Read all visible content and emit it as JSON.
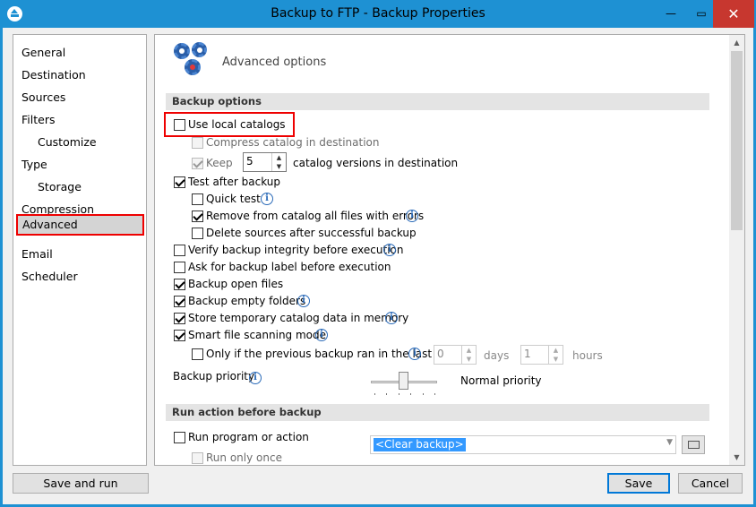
{
  "window": {
    "title": "Backup to FTP - Backup Properties",
    "min_glyph": "—",
    "max_glyph": "▭",
    "close_glyph": "✕"
  },
  "nav": {
    "items": [
      {
        "label": "General"
      },
      {
        "label": "Destination"
      },
      {
        "label": "Sources"
      },
      {
        "label": "Filters"
      },
      {
        "label": "Customize"
      },
      {
        "label": "Type"
      },
      {
        "label": "Storage"
      },
      {
        "label": "Compression"
      },
      {
        "label": "Advanced",
        "selected": true
      },
      {
        "label": "Email"
      },
      {
        "label": "Scheduler"
      }
    ]
  },
  "header": {
    "title": "Advanced options",
    "icon": "gears-icon"
  },
  "sections": {
    "backup_options": "Backup options",
    "run_action": "Run action before backup"
  },
  "options": {
    "use_local_catalogs": {
      "label": "Use local catalogs",
      "checked": false
    },
    "compress_catalog": {
      "label": "Compress catalog in destination",
      "checked": false,
      "disabled": true
    },
    "keep": {
      "label": "Keep",
      "checked": true,
      "disabled": true,
      "value": "5",
      "suffix": "catalog versions in destination"
    },
    "test_after_backup": {
      "label": "Test after backup",
      "checked": true
    },
    "quick_test": {
      "label": "Quick test",
      "checked": false
    },
    "remove_from_catalog": {
      "label": "Remove from catalog all files with errors",
      "checked": true
    },
    "delete_sources": {
      "label": "Delete sources after successful backup",
      "checked": false
    },
    "verify_integrity": {
      "label": "Verify backup integrity before execution",
      "checked": false
    },
    "ask_label": {
      "label": "Ask for backup label before execution",
      "checked": false
    },
    "backup_open_files": {
      "label": "Backup open files",
      "checked": true
    },
    "backup_empty_folders": {
      "label": "Backup empty folders",
      "checked": true
    },
    "store_temp_catalog": {
      "label": "Store temporary catalog data in memory",
      "checked": true
    },
    "smart_scanning": {
      "label": "Smart file scanning mode",
      "checked": true
    },
    "only_if_previous": {
      "label": "Only if the previous backup ran in the last",
      "checked": false,
      "days_value": "0",
      "days_label": "days",
      "hours_value": "1",
      "hours_label": "hours"
    },
    "priority": {
      "label": "Backup priority",
      "value_label": "Normal priority",
      "level": 0.5
    },
    "run_program": {
      "label": "Run program or action",
      "checked": false,
      "combo_value": "<Clear backup>"
    },
    "run_only_once": {
      "label": "Run only once",
      "checked": false,
      "disabled": true
    }
  },
  "buttons": {
    "save_and_run": "Save and run",
    "save": "Save",
    "cancel": "Cancel"
  },
  "colors": {
    "titlebar": "#1e91d3",
    "close": "#c7372f",
    "highlight": "#ee0000",
    "selection": "#3399ff"
  }
}
